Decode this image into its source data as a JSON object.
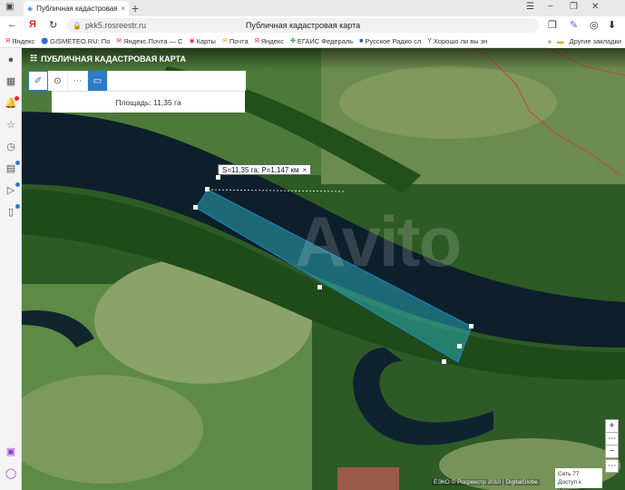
{
  "browser": {
    "tab_title": "Публичная кадастровая",
    "tab_close": "×",
    "new_tab": "+",
    "url": "pkk5.rosreestr.ru",
    "page_title": "Публичная кадастровая карта",
    "bookmarks": [
      {
        "label": "Яндекс",
        "icon": "Я",
        "color": "#e22"
      },
      {
        "label": "GISMETEO.RU: По",
        "icon": "⬤",
        "color": "#2b6fd0"
      },
      {
        "label": "Яндекс.Почта — С",
        "icon": "✉",
        "color": "#e22"
      },
      {
        "label": "Карты",
        "icon": "◉",
        "color": "#e33"
      },
      {
        "label": "Почта",
        "icon": "✉",
        "color": "#e8a20c"
      },
      {
        "label": "Яндекс",
        "icon": "Я",
        "color": "#e22"
      },
      {
        "label": "ЕГАИС Федераль",
        "icon": "✤",
        "color": "#2a9d3c"
      },
      {
        "label": "Русское Радио сл",
        "icon": "■",
        "color": "#2255aa"
      },
      {
        "label": "Хорошо ли вы зн",
        "icon": "Y",
        "color": "#c00"
      }
    ],
    "bookmarks_more": "»",
    "other_bookmarks": "Другие закладки"
  },
  "app": {
    "title": "ПУБЛИЧНАЯ КАДАСТРОВАЯ КАРТА",
    "area_text": "Площадь: 11,35 га",
    "measure_label": "S=11,35 га; P=1,147 км",
    "measure_close": "×"
  },
  "map": {
    "watermark": "Avito",
    "zoom_in": "+",
    "zoom_out": "−",
    "menu": "⋯",
    "attribution": "ЕЭКО © Росреестр 2010 | DigitalGlobe",
    "net_line1": "Сеть  77",
    "net_line2": "Доступ к Интернету"
  },
  "colors": {
    "accent": "#2f7bc7",
    "polygon_fill": "#2bb3c0",
    "polygon_stroke": "#1e88c8"
  }
}
